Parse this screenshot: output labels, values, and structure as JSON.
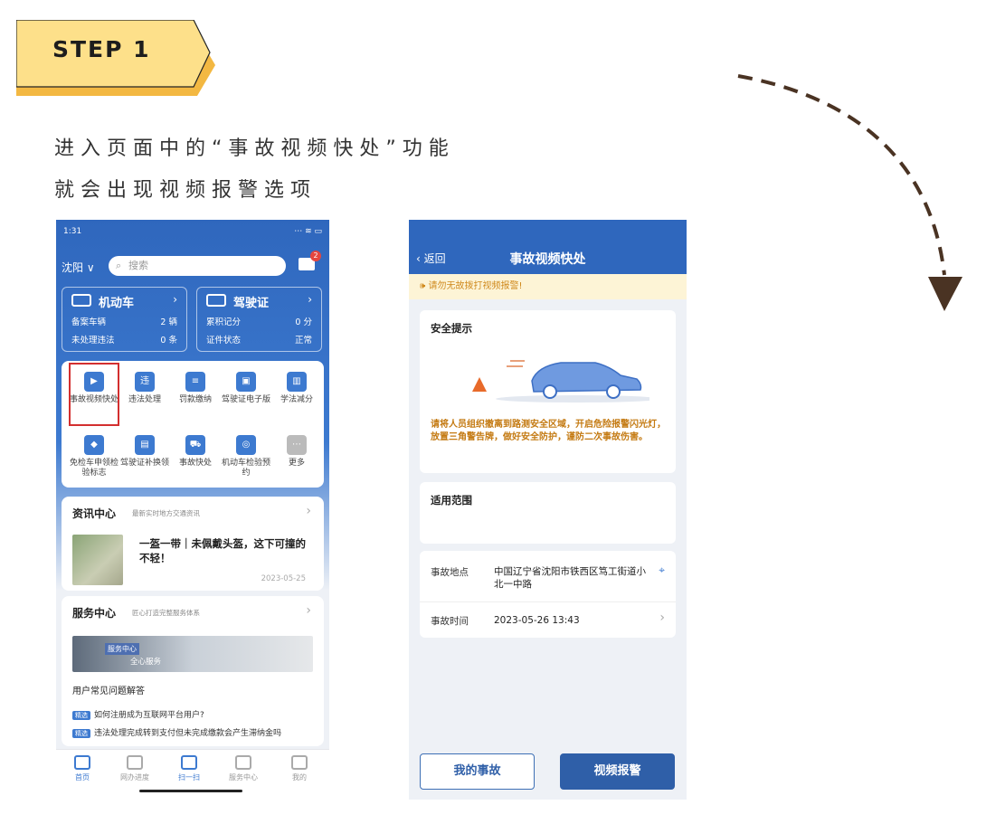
{
  "step": {
    "label": "STEP 1"
  },
  "intro": {
    "line1": "进入页面中的“事故视频快处”功能",
    "line2": "就会出现视频报警选项"
  },
  "colors": {
    "banner_yellow": "#fde08a",
    "banner_shadow": "#f3b842",
    "brand_blue": "#2f67bd",
    "arrow": "#4a3323"
  },
  "phone1": {
    "status": {
      "time": "1:31",
      "right": "⋯ ≋ ▭"
    },
    "city": "沈阳 ∨",
    "search_placeholder": "搜索",
    "mail_badge": "2",
    "vehicle_card": {
      "title": "机动车",
      "rows": [
        {
          "label": "备案车辆",
          "value": "2 辆"
        },
        {
          "label": "未处理违法",
          "value": "0 条"
        }
      ]
    },
    "license_card": {
      "title": "驾驶证",
      "rows": [
        {
          "label": "累积记分",
          "value": "0 分"
        },
        {
          "label": "证件状态",
          "value": "正常"
        }
      ]
    },
    "services": [
      {
        "label": "事故视频快处",
        "icon": "alarm-icon"
      },
      {
        "label": "违法处理",
        "icon": "violation-icon"
      },
      {
        "label": "罚款缴纳",
        "icon": "fine-icon"
      },
      {
        "label": "驾驶证电子版",
        "icon": "license-icon"
      },
      {
        "label": "学法减分",
        "icon": "book-icon"
      },
      {
        "label": "免检车申领检验标志",
        "icon": "exempt-icon"
      },
      {
        "label": "驾驶证补换领",
        "icon": "id-card-icon"
      },
      {
        "label": "事故快处",
        "icon": "accident-icon"
      },
      {
        "label": "机动车检验预约",
        "icon": "inspection-icon"
      },
      {
        "label": "更多",
        "icon": "more-icon"
      }
    ],
    "news": {
      "title": "资讯中心",
      "subtitle": "最新实时地方交通资讯",
      "headline": "一盔一带｜未佩戴头盔，这下可撞的不轻！",
      "date": "2023-05-25"
    },
    "service_center": {
      "title": "服务中心",
      "subtitle": "匠心打造完整服务体系",
      "banner_tag": "服务中心",
      "banner_text": "全心服务",
      "faq_title": "用户常见问题解答",
      "faq_tag": "精选",
      "faqs": [
        "如何注册成为互联网平台用户?",
        "违法处理完成转到支付但未完成缴款会产生滞纳金吗"
      ]
    },
    "tabs": [
      {
        "label": "首页"
      },
      {
        "label": "网办进度"
      },
      {
        "label": "扫一扫"
      },
      {
        "label": "服务中心"
      },
      {
        "label": "我的"
      }
    ]
  },
  "phone2": {
    "back_label": "返回",
    "title": "事故视频快处",
    "warning": "请勿无故拨打视频报警!",
    "safety": {
      "heading": "安全提示",
      "text": "请将人员组织撤离到路测安全区域，开启危险报警闪光灯，放置三角警告牌，做好安全防护，谨防二次事故伤害。"
    },
    "scope": {
      "heading": "适用范围"
    },
    "location": {
      "label": "事故地点",
      "value": "中国辽宁省沈阳市铁西区笃工街道小北一中路"
    },
    "time": {
      "label": "事故时间",
      "value": "2023-05-26 13:43"
    },
    "buttons": {
      "mine": "我的事故",
      "report": "视频报警"
    }
  }
}
